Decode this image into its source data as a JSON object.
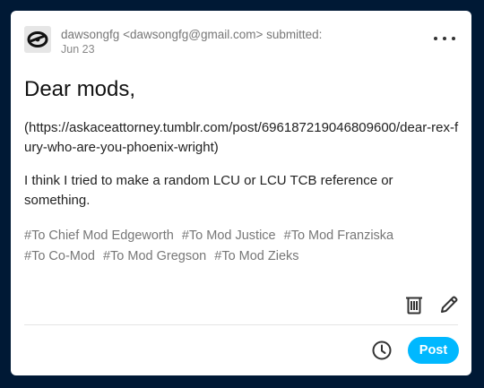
{
  "submission": {
    "username": "dawsongfg",
    "email": "<dawsongfg@gmail.com>",
    "action": "submitted:",
    "date": "Jun 23",
    "more_icon": "ellipsis-icon"
  },
  "post": {
    "title": "Dear mods,",
    "link_text": "(https://askaceattorney.tumblr.com/post/696187219046809600/dear-rex-fury-who-are-you-phoenix-wright)",
    "body": "I think I tried to make a random LCU or LCU TCB reference or something."
  },
  "tags": [
    "#To Chief Mod Edgeworth",
    "#To Mod Justice",
    "#To Mod Franziska",
    "#To Co-Mod",
    "#To Mod Gregson",
    "#To Mod Zieks"
  ],
  "actions": {
    "delete_icon": "trash-icon",
    "edit_icon": "pencil-icon",
    "schedule_icon": "clock-icon",
    "post_label": "Post"
  },
  "colors": {
    "background": "#001935",
    "card": "#ffffff",
    "accent": "#00b8ff",
    "muted_text": "#777777"
  }
}
